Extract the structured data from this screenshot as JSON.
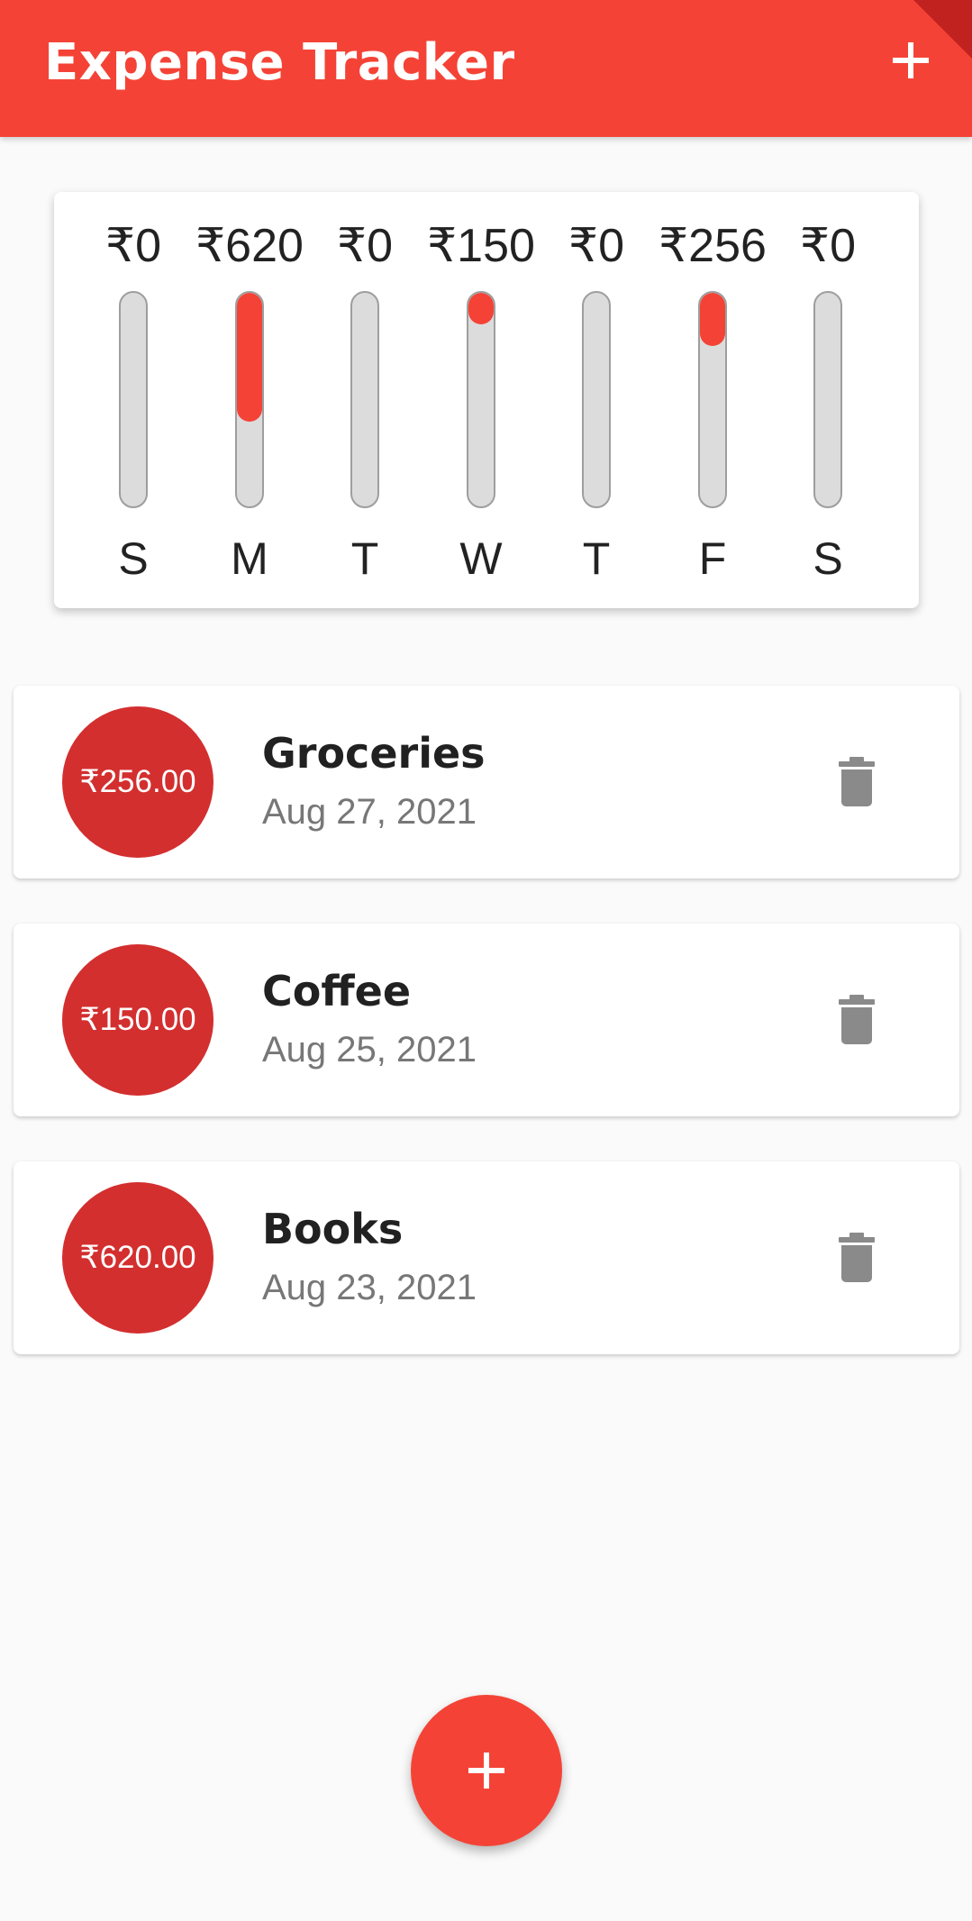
{
  "appbar": {
    "title": "Expense Tracker",
    "add_icon": "plus-icon"
  },
  "weekly_chart": {
    "days": [
      {
        "label": "S",
        "amount_text": "₹0",
        "fraction": 0.0
      },
      {
        "label": "M",
        "amount_text": "₹620",
        "fraction": 0.605
      },
      {
        "label": "T",
        "amount_text": "₹0",
        "fraction": 0.0
      },
      {
        "label": "W",
        "amount_text": "₹150",
        "fraction": 0.146
      },
      {
        "label": "T",
        "amount_text": "₹0",
        "fraction": 0.0
      },
      {
        "label": "F",
        "amount_text": "₹256",
        "fraction": 0.25
      },
      {
        "label": "S",
        "amount_text": "₹0",
        "fraction": 0.0
      }
    ],
    "fill_color": "#f44336"
  },
  "transactions": [
    {
      "amount": "₹256.00",
      "title": "Groceries",
      "date": "Aug 27, 2021",
      "delete_icon": "trash-icon"
    },
    {
      "amount": "₹150.00",
      "title": "Coffee",
      "date": "Aug 25, 2021",
      "delete_icon": "trash-icon"
    },
    {
      "amount": "₹620.00",
      "title": "Books",
      "date": "Aug 23, 2021",
      "delete_icon": "trash-icon"
    }
  ],
  "fab": {
    "icon": "plus-icon"
  },
  "colors": {
    "primary": "#f44336",
    "avatar": "#d32f2f",
    "background": "#fafafa"
  }
}
